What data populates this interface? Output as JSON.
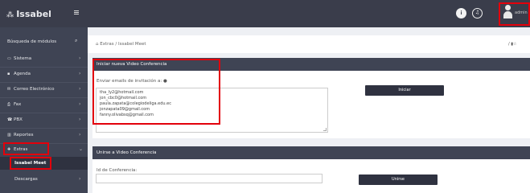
{
  "app": {
    "logo_text": "Issabel",
    "logo_icon": "star-grid-icon"
  },
  "sidebar": {
    "search_label": "Búsqueda de módulos",
    "items": [
      {
        "label": "Sistema",
        "icon": "monitor-icon",
        "glyph": "▭"
      },
      {
        "label": "Agenda",
        "icon": "book-icon",
        "glyph": "▪"
      },
      {
        "label": "Correo Electrónico",
        "icon": "envelope-icon",
        "glyph": "✉"
      },
      {
        "label": "Fax",
        "icon": "printer-icon",
        "glyph": "⎙"
      },
      {
        "label": "PBX",
        "icon": "phone-icon",
        "glyph": "☎"
      },
      {
        "label": "Reportes",
        "icon": "bar-chart-icon",
        "glyph": "▥"
      },
      {
        "label": "Extras",
        "icon": "plus-icon",
        "glyph": "✚"
      }
    ],
    "sub_items": [
      {
        "label": "Issabel Meet"
      },
      {
        "label": "Descargas"
      }
    ]
  },
  "topbar": {
    "user_name": "admin"
  },
  "breadcrumb": {
    "items": [
      "Extras",
      "Issabel Meet"
    ],
    "separator": "/",
    "right_text": "/"
  },
  "new_conference": {
    "title": "Iniciar nueva Video Conferencia",
    "emails_label": "Enviar emails de invitación a:",
    "emails": [
      "tha_ly2@hotmail.com",
      "jon_cbc0@hotmail.com",
      "paula.zapata@colegiodeliga.edu.ec",
      "jonzapata09@gmail.com",
      "fanny.olivabsq@gmail.com"
    ],
    "start_button": "Iniciar"
  },
  "join_conference": {
    "title": "Unirse a Video Conferencia",
    "id_label": "Id de Conferencia:",
    "id_value": "",
    "join_button": "Unirse"
  },
  "colors": {
    "sidebar": "#3f4454",
    "topbar": "#3a3d4b",
    "highlight": "#e3000b",
    "button": "#2f3240"
  }
}
